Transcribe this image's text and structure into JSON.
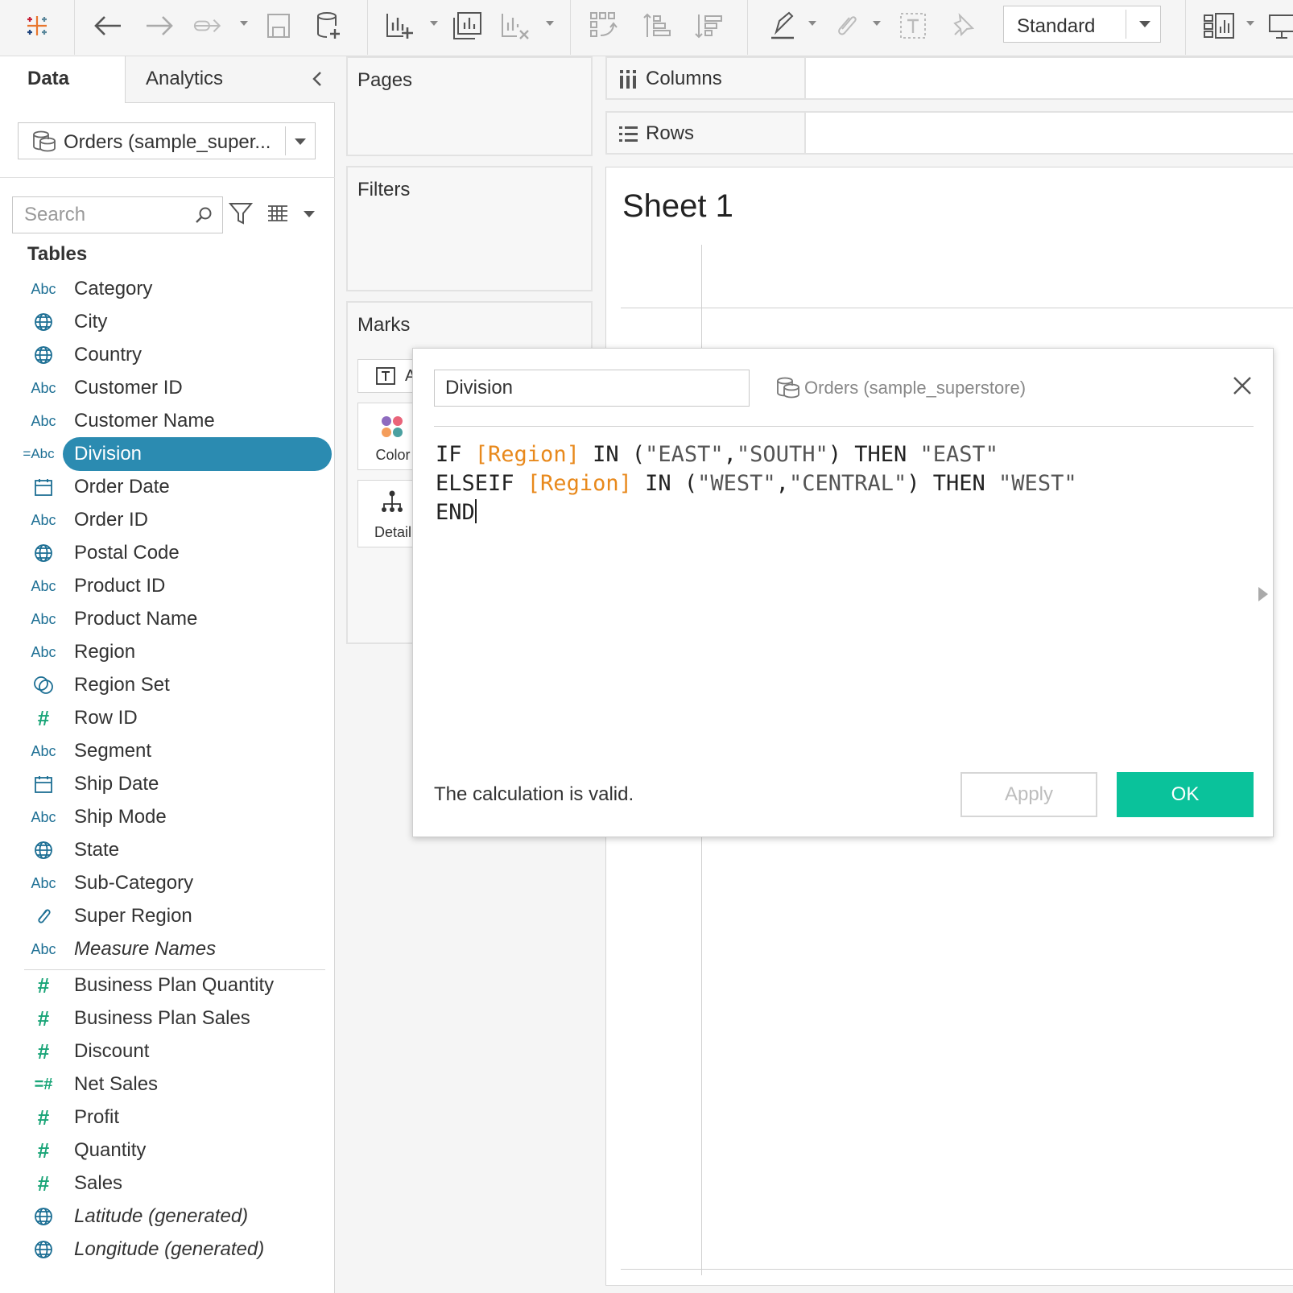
{
  "toolbar": {
    "view_select": "Standard",
    "icons": [
      "tableau-logo-icon",
      "undo-icon",
      "redo-icon",
      "replay-icon",
      "save-icon",
      "new-datasource-icon",
      "new-worksheet-icon",
      "duplicate-sheet-icon",
      "clear-sheet-icon",
      "swap-icon",
      "sort-ascending-icon",
      "sort-descending-icon",
      "highlight-icon",
      "group-icon",
      "label-icon",
      "pin-icon",
      "show-me-icon",
      "presentation-icon"
    ]
  },
  "data_pane": {
    "tab_data": "Data",
    "tab_analytics": "Analytics",
    "datasource": "Orders (sample_super...",
    "search_placeholder": "Search",
    "tables_heading": "Tables",
    "dimensions": [
      {
        "icon": "Abc",
        "type": "abc",
        "name": "Category"
      },
      {
        "icon": "globe",
        "type": "globe",
        "name": "City"
      },
      {
        "icon": "globe",
        "type": "globe",
        "name": "Country"
      },
      {
        "icon": "Abc",
        "type": "abc",
        "name": "Customer ID"
      },
      {
        "icon": "Abc",
        "type": "abc",
        "name": "Customer Name"
      },
      {
        "icon": "=Abc",
        "type": "eqabc",
        "name": "Division",
        "selected": true
      },
      {
        "icon": "calendar",
        "type": "calendar",
        "name": "Order Date"
      },
      {
        "icon": "Abc",
        "type": "abc",
        "name": "Order ID"
      },
      {
        "icon": "globe",
        "type": "globe",
        "name": "Postal Code"
      },
      {
        "icon": "Abc",
        "type": "abc",
        "name": "Product ID"
      },
      {
        "icon": "Abc",
        "type": "abc",
        "name": "Product Name"
      },
      {
        "icon": "Abc",
        "type": "abc",
        "name": "Region"
      },
      {
        "icon": "set",
        "type": "set",
        "name": "Region Set"
      },
      {
        "icon": "#",
        "type": "hash",
        "name": "Row ID"
      },
      {
        "icon": "Abc",
        "type": "abc",
        "name": "Segment"
      },
      {
        "icon": "calendar",
        "type": "calendar",
        "name": "Ship Date"
      },
      {
        "icon": "Abc",
        "type": "abc",
        "name": "Ship Mode"
      },
      {
        "icon": "globe",
        "type": "globe",
        "name": "State"
      },
      {
        "icon": "Abc",
        "type": "abc",
        "name": "Sub-Category"
      },
      {
        "icon": "paperclip",
        "type": "clip",
        "name": "Super Region"
      },
      {
        "icon": "Abc",
        "type": "abc",
        "name": "Measure Names",
        "italic": true
      }
    ],
    "measures": [
      {
        "icon": "#",
        "type": "hash",
        "name": "Business Plan Quantity"
      },
      {
        "icon": "#",
        "type": "hash",
        "name": "Business Plan Sales"
      },
      {
        "icon": "#",
        "type": "hash",
        "name": "Discount"
      },
      {
        "icon": "=#",
        "type": "eqhash",
        "name": "Net Sales"
      },
      {
        "icon": "#",
        "type": "hash",
        "name": "Profit"
      },
      {
        "icon": "#",
        "type": "hash",
        "name": "Quantity"
      },
      {
        "icon": "#",
        "type": "hash",
        "name": "Sales"
      },
      {
        "icon": "globe",
        "type": "globe",
        "name": "Latitude (generated)",
        "italic": true
      },
      {
        "icon": "globe",
        "type": "globe",
        "name": "Longitude (generated)",
        "italic": true
      }
    ]
  },
  "cards": {
    "pages": "Pages",
    "filters": "Filters",
    "marks": "Marks",
    "marks_type_partial": "A",
    "color": "Color",
    "detail": "Detail"
  },
  "shelves": {
    "columns": "Columns",
    "rows": "Rows"
  },
  "sheet": {
    "title": "Sheet 1"
  },
  "calc_dialog": {
    "name": "Division",
    "datasource": "Orders (sample_superstore)",
    "code_lines": [
      [
        {
          "t": "kw",
          "v": "IF "
        },
        {
          "t": "fld",
          "v": "[Region]"
        },
        {
          "t": "kw",
          "v": " IN ("
        },
        {
          "t": "str",
          "v": "\"EAST\""
        },
        {
          "t": "kw",
          "v": ","
        },
        {
          "t": "str",
          "v": "\"SOUTH\""
        },
        {
          "t": "kw",
          "v": ") THEN "
        },
        {
          "t": "str",
          "v": "\"EAST\""
        }
      ],
      [
        {
          "t": "kw",
          "v": "ELSEIF "
        },
        {
          "t": "fld",
          "v": "[Region]"
        },
        {
          "t": "kw",
          "v": " IN ("
        },
        {
          "t": "str",
          "v": "\"WEST\""
        },
        {
          "t": "kw",
          "v": ","
        },
        {
          "t": "str",
          "v": "\"CENTRAL\""
        },
        {
          "t": "kw",
          "v": ") THEN "
        },
        {
          "t": "str",
          "v": "\"WEST\""
        }
      ],
      [
        {
          "t": "kw",
          "v": "END"
        }
      ]
    ],
    "status": "The calculation is valid.",
    "apply": "Apply",
    "ok": "OK"
  },
  "colors": {
    "selected_pill": "#2b8bb1",
    "ok_button": "#0ac29b",
    "field_ref": "#e8891c",
    "measure_green": "#1aa578",
    "dimension_blue": "#1d6f94"
  }
}
